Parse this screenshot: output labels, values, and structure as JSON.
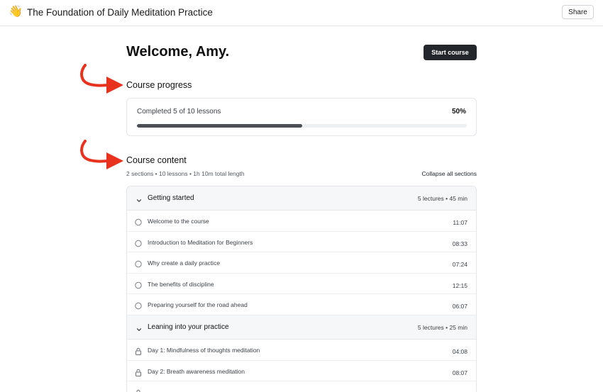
{
  "header": {
    "emoji": "👋",
    "title": "The Foundation of Daily Meditation Practice",
    "share_label": "Share"
  },
  "welcome": {
    "heading": "Welcome, Amy.",
    "start_label": "Start course"
  },
  "progress": {
    "heading": "Course progress",
    "label": "Completed 5 of 10 lessons",
    "percent_text": "50%",
    "fraction": 0.5
  },
  "content": {
    "heading": "Course content",
    "meta": "2 sections • 10 lessons • 1h 10m total length",
    "collapse_label": "Collapse all sections",
    "sections": [
      {
        "title": "Getting started",
        "meta": "5 lectures • 45 min",
        "lessons": [
          {
            "title": "Welcome to the course",
            "duration": "11:07",
            "icon": "circle-icon"
          },
          {
            "title": "Introduction to Meditation for Beginners",
            "duration": "08:33",
            "icon": "circle-icon"
          },
          {
            "title": "Why create a daily practice",
            "duration": "07:24",
            "icon": "circle-icon"
          },
          {
            "title": "The benefits of discipline",
            "duration": "12:15",
            "icon": "circle-icon"
          },
          {
            "title": "Preparing yourself for the road ahead",
            "duration": "06:07",
            "icon": "circle-icon"
          }
        ]
      },
      {
        "title": "Leaning into your practice",
        "meta": "5 lectures • 25 min",
        "lessons": [
          {
            "title": "Day 1: Mindfulness of thoughts meditation",
            "duration": "04:08",
            "icon": "lock-icon"
          },
          {
            "title": "Day 2: Breath awareness meditation",
            "duration": "08:07",
            "icon": "lock-icon"
          },
          {
            "title": "",
            "duration": "",
            "icon": "lock-icon"
          }
        ]
      }
    ]
  },
  "colors": {
    "annotation_arrow": "#e8321e",
    "primary_button": "#23262b",
    "progress_fill": "#4a4e55"
  }
}
